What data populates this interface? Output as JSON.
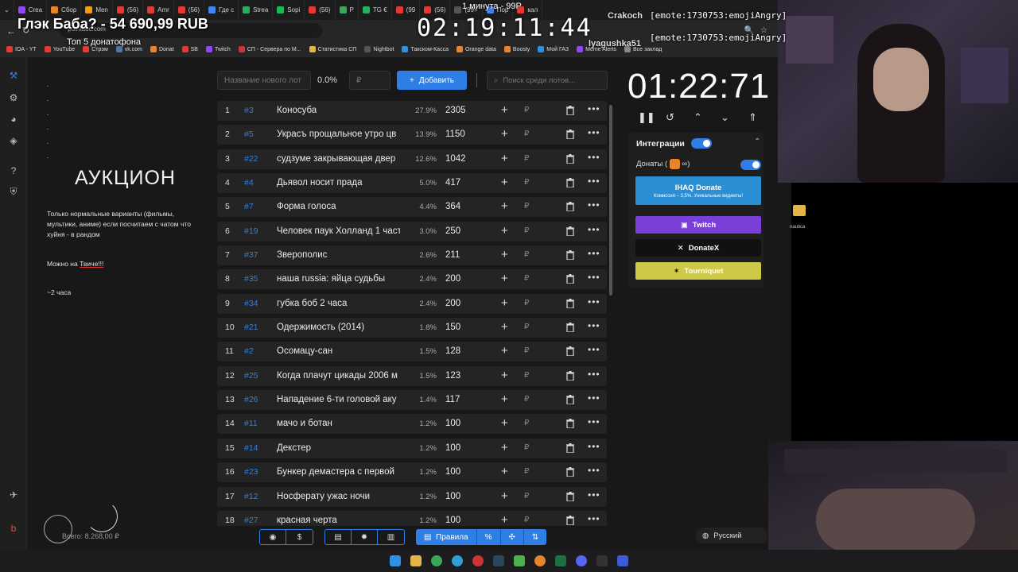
{
  "tabs": [
    "Crea",
    "Сбор",
    "Men",
    "(56)",
    "Amr",
    "(56)",
    "Где с",
    "Strea",
    "Sopi",
    "(56)",
    "P",
    "TG €",
    "(99",
    "(56)",
    "(99+",
    "Пор",
    "кал"
  ],
  "address": "pointauc.com",
  "bookmarks": [
    "IOA - YT",
    "YouTube",
    "Стрэм",
    "vk.com",
    "Donat",
    "SB",
    "Twitch",
    "СП - Сервера по М...",
    "Статистика СП",
    "Nightbot",
    "Такском-Касса",
    "Orange data",
    "Boosty",
    "Мой ГАЗ",
    "Meme Alerts",
    "Все заклад"
  ],
  "overlay": {
    "title": "Глэк Баба? - 54 690,99 RUB",
    "subtitle": "Топ 5 донатофона",
    "big_timer": "02:19:11:44",
    "top_caption": "1 минута - 99Р",
    "chat": [
      {
        "user": "Crakoch",
        "msg": "[emote:1730753:emojiAngry]"
      },
      {
        "user": "lyagushka51",
        "msg": "[emote:1730753:emojiAngry]"
      }
    ]
  },
  "sidebar": {
    "dots": [
      ".",
      ".",
      ".",
      ".",
      ".",
      "."
    ],
    "title": "АУКЦИОН",
    "desc": "Только нормальные варианты (фильмы, мультики, аниме) если посчитаем с чатом что хуйня - в рандом",
    "desc2_prefix": "Можно на ",
    "desc2_link": "Твиче!!!",
    "desc3": "~2 часа",
    "total": "Всего: 8.268,00 ₽"
  },
  "controls": {
    "name_placeholder": "Название нового лот",
    "percent": "0.0%",
    "amount_placeholder": "₽",
    "add_label": "Добавить",
    "search_placeholder": "Поиск среди лотов..."
  },
  "lots": [
    {
      "n": "1",
      "id": "#3",
      "name": "Коносуба",
      "pct": "27.9%",
      "amount": "2305"
    },
    {
      "n": "2",
      "id": "#5",
      "name": "Украсъ прощальное утро цв",
      "pct": "13.9%",
      "amount": "1150"
    },
    {
      "n": "3",
      "id": "#22",
      "name": "судзуме закрывающая двер",
      "pct": "12.6%",
      "amount": "1042"
    },
    {
      "n": "4",
      "id": "#4",
      "name": "Дьявол носит прада",
      "pct": "5.0%",
      "amount": "417"
    },
    {
      "n": "5",
      "id": "#7",
      "name": "Форма голоса",
      "pct": "4.4%",
      "amount": "364"
    },
    {
      "n": "6",
      "id": "#19",
      "name": "Человек паук Холланд 1 част",
      "pct": "3.0%",
      "amount": "250"
    },
    {
      "n": "7",
      "id": "#37",
      "name": "Зверополис",
      "pct": "2.6%",
      "amount": "211"
    },
    {
      "n": "8",
      "id": "#35",
      "name": "наша russia: яйца судьбы",
      "pct": "2.4%",
      "amount": "200"
    },
    {
      "n": "9",
      "id": "#34",
      "name": "губка боб 2 часа",
      "pct": "2.4%",
      "amount": "200"
    },
    {
      "n": "10",
      "id": "#21",
      "name": "Одержимость (2014)",
      "pct": "1.8%",
      "amount": "150"
    },
    {
      "n": "11",
      "id": "#2",
      "name": "Осомацу-сан",
      "pct": "1.5%",
      "amount": "128"
    },
    {
      "n": "12",
      "id": "#25",
      "name": "Когда плачут цикады 2006 м",
      "pct": "1.5%",
      "amount": "123"
    },
    {
      "n": "13",
      "id": "#26",
      "name": "Нападение 6-ти головой аку",
      "pct": "1.4%",
      "amount": "117"
    },
    {
      "n": "14",
      "id": "#11",
      "name": "мачо и ботан",
      "pct": "1.2%",
      "amount": "100"
    },
    {
      "n": "15",
      "id": "#14",
      "name": "Декстер",
      "pct": "1.2%",
      "amount": "100"
    },
    {
      "n": "16",
      "id": "#23",
      "name": "Бункер демастера с первой",
      "pct": "1.2%",
      "amount": "100"
    },
    {
      "n": "17",
      "id": "#12",
      "name": "Носферату ужас ночи",
      "pct": "1.2%",
      "amount": "100"
    },
    {
      "n": "18",
      "id": "#27",
      "name": "красная черта",
      "pct": "1.2%",
      "amount": "100"
    }
  ],
  "timer": "01:22:71",
  "integrations": {
    "header": "Интеграции",
    "donations_label": "Донаты (",
    "ihaq_title": "IHAQ Donate",
    "ihaq_sub": "Комиссия – 3,5%. Уникальные виджеты!",
    "twitch": "Twitch",
    "donatex": "DonateX",
    "tourniquet": "Tourniquet"
  },
  "language": "Русский",
  "bottom": {
    "rules": "Правила"
  },
  "desktop": {
    "folder_label": "nautica"
  },
  "colors": {
    "accent": "#2f7ee6",
    "twitch": "#7a3fd6",
    "tourniquet": "#cfc94a",
    "ihaq": "#2b8fd6"
  }
}
